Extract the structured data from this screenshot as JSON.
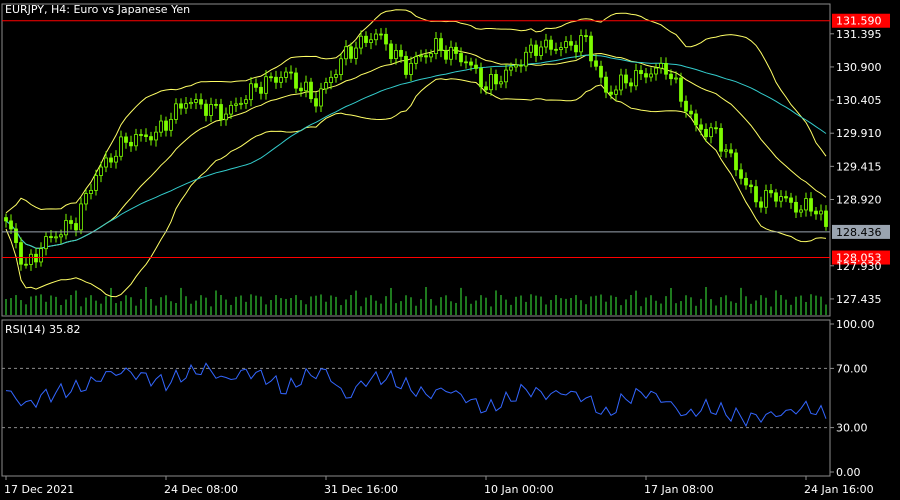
{
  "chart_data": [
    {
      "type": "candlestick",
      "title": "EURJPY, H4:  Euro vs Japanese Yen",
      "y_ticks": [
        "131.395",
        "130.900",
        "130.405",
        "129.910",
        "129.415",
        "128.920",
        "127.930",
        "127.435"
      ],
      "ylim": [
        127.18,
        131.84
      ],
      "x_ticks": [
        {
          "label": "17 Dec 2021",
          "index": 0
        },
        {
          "label": "24 Dec 08:00",
          "index": 32
        },
        {
          "label": "31 Dec 16:00",
          "index": 64
        },
        {
          "label": "10 Jan 00:00",
          "index": 96
        },
        {
          "label": "17 Jan 08:00",
          "index": 128
        },
        {
          "label": "24 Jan 16:00",
          "index": 160
        }
      ],
      "levels": [
        {
          "label": "131.590",
          "value": 131.59,
          "color": "#ff0000"
        },
        {
          "label": "128.053",
          "value": 128.053,
          "color": "#ff0000"
        }
      ],
      "current_price": {
        "label": "128.436",
        "value": 128.436,
        "color": "#9aa4b0"
      },
      "closes_anchors": [
        [
          0,
          128.6
        ],
        [
          4,
          127.9
        ],
        [
          8,
          128.3
        ],
        [
          14,
          128.6
        ],
        [
          18,
          129.3
        ],
        [
          24,
          129.8
        ],
        [
          30,
          129.9
        ],
        [
          36,
          130.4
        ],
        [
          44,
          130.2
        ],
        [
          50,
          130.6
        ],
        [
          56,
          130.8
        ],
        [
          62,
          130.4
        ],
        [
          68,
          131.1
        ],
        [
          74,
          131.4
        ],
        [
          80,
          130.9
        ],
        [
          86,
          131.2
        ],
        [
          92,
          131.0
        ],
        [
          96,
          130.6
        ],
        [
          100,
          130.8
        ],
        [
          106,
          131.2
        ],
        [
          112,
          131.2
        ],
        [
          116,
          131.3
        ],
        [
          120,
          130.5
        ],
        [
          124,
          130.7
        ],
        [
          128,
          130.8
        ],
        [
          132,
          130.9
        ],
        [
          134,
          130.6
        ],
        [
          138,
          130.0
        ],
        [
          142,
          129.9
        ],
        [
          146,
          129.4
        ],
        [
          150,
          128.9
        ],
        [
          154,
          129.0
        ],
        [
          158,
          128.8
        ],
        [
          162,
          128.8
        ],
        [
          164,
          128.5
        ]
      ],
      "bar_count": 165,
      "candle_color": "#7cfc00",
      "bollinger_color": "#ffff66",
      "ma_color": "#33cccc",
      "volume_color": "#33cc33"
    },
    {
      "type": "line",
      "title": "RSI(14) 35.82",
      "y_ticks": [
        "100.00",
        "70.00",
        "30.00",
        "0.00"
      ],
      "ylim": [
        0,
        100
      ],
      "levels": [
        70,
        30
      ],
      "line_color": "#3366ff",
      "values_anchors": [
        [
          0,
          55
        ],
        [
          4,
          45
        ],
        [
          8,
          52
        ],
        [
          12,
          55
        ],
        [
          16,
          58
        ],
        [
          20,
          66
        ],
        [
          24,
          68
        ],
        [
          28,
          64
        ],
        [
          32,
          60
        ],
        [
          36,
          66
        ],
        [
          40,
          70
        ],
        [
          44,
          62
        ],
        [
          48,
          68
        ],
        [
          52,
          64
        ],
        [
          56,
          55
        ],
        [
          60,
          65
        ],
        [
          64,
          68
        ],
        [
          68,
          50
        ],
        [
          72,
          62
        ],
        [
          76,
          64
        ],
        [
          80,
          58
        ],
        [
          84,
          52
        ],
        [
          88,
          56
        ],
        [
          92,
          50
        ],
        [
          96,
          42
        ],
        [
          100,
          48
        ],
        [
          104,
          56
        ],
        [
          108,
          52
        ],
        [
          112,
          54
        ],
        [
          116,
          50
        ],
        [
          120,
          38
        ],
        [
          124,
          50
        ],
        [
          128,
          54
        ],
        [
          132,
          48
        ],
        [
          136,
          38
        ],
        [
          140,
          44
        ],
        [
          144,
          40
        ],
        [
          148,
          36
        ],
        [
          152,
          38
        ],
        [
          156,
          40
        ],
        [
          160,
          44
        ],
        [
          164,
          38
        ]
      ]
    }
  ]
}
